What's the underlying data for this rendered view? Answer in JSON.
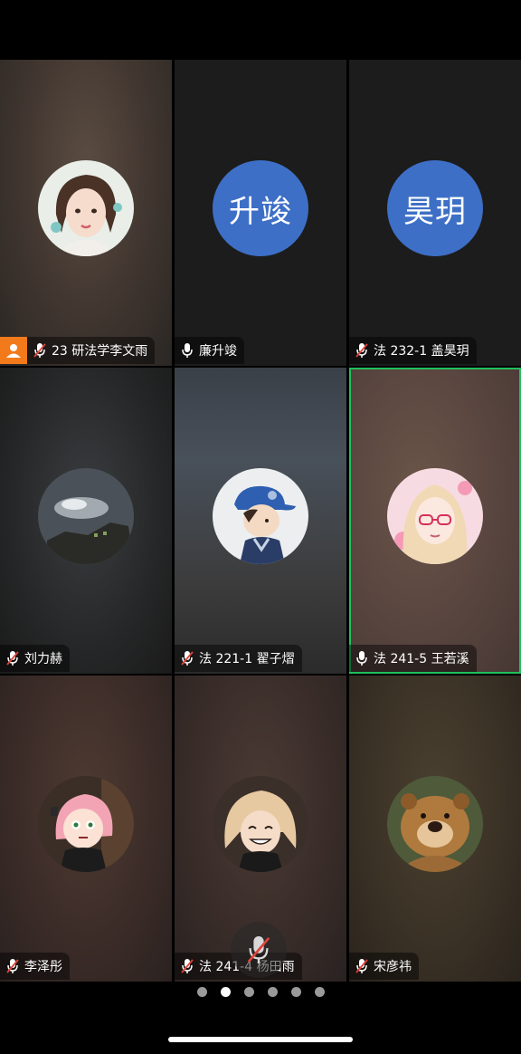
{
  "participants": [
    {
      "name": "23 研法学李文雨",
      "avatar": "illustrated-girl-avatar",
      "mic": "muted",
      "host": true
    },
    {
      "name": "廉升竣",
      "initials": "升竣",
      "mic": "on"
    },
    {
      "name": "法 232-1 盖昊玥",
      "initials": "昊玥",
      "mic": "muted"
    },
    {
      "name": "刘力赫",
      "avatar": "night-sky-photo-avatar",
      "mic": "muted"
    },
    {
      "name": "法 221-1 翟子熠",
      "avatar": "cartoon-boy-cap-avatar",
      "mic": "muted"
    },
    {
      "name": "法 241-5 王若溪",
      "avatar": "anime-girl-glasses-avatar",
      "mic": "on",
      "active_speaker": true
    },
    {
      "name": "李泽彤",
      "avatar": "anime-pink-hair-avatar",
      "mic": "muted"
    },
    {
      "name": "法 241-4 杨田雨",
      "avatar": "anime-blond-boy-avatar",
      "mic": "muted"
    },
    {
      "name": "宋彦祎",
      "avatar": "cartoon-bear-avatar",
      "mic": "muted"
    }
  ],
  "pagination": {
    "total": 6,
    "current": 2
  },
  "colors": {
    "active_border": "#20c05c",
    "host_badge": "#f27a1b",
    "initials_bg": "#3d6fc6"
  }
}
